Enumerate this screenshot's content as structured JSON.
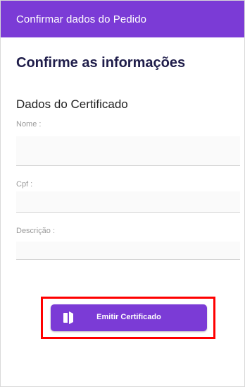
{
  "app_bar": {
    "title": "Confirmar dados do Pedido"
  },
  "page": {
    "title": "Confirme as informações",
    "section_title": "Dados do Certificado"
  },
  "form": {
    "fields": [
      {
        "label": "Nome :",
        "value": ""
      },
      {
        "label": "Cpf :",
        "value": ""
      },
      {
        "label": "Descrição :",
        "value": ""
      }
    ]
  },
  "actions": {
    "submit_label": "Emitir Certificado",
    "submit_icon": "certificate-icon"
  },
  "colors": {
    "primary": "#7b3bd6",
    "title_text": "#1f1d4a",
    "highlight": "#ff0000"
  }
}
